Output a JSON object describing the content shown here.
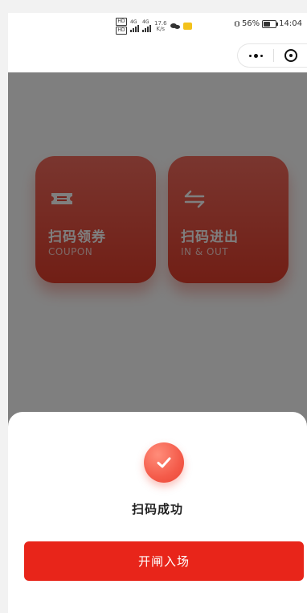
{
  "status_bar": {
    "sim1": "HD",
    "sim2": "HD",
    "net1": "4G",
    "net2": "4G",
    "net_speed_value": "17.6",
    "net_speed_unit": "K/s",
    "battery_text": "56%",
    "battery_level": 0.56,
    "time": "14:04",
    "icons": [
      "hd-icon",
      "signal-icon",
      "wechat-icon",
      "message-icon",
      "vibrate-icon",
      "battery-icon"
    ]
  },
  "capsule": {
    "more_icon": "more-dots-icon",
    "close_icon": "close-target-icon"
  },
  "cards": [
    {
      "title": "扫码领券",
      "subtitle": "COUPON",
      "icon": "ticket-icon"
    },
    {
      "title": "扫码进出",
      "subtitle": "IN & OUT",
      "icon": "swap-arrows-icon"
    }
  ],
  "sheet": {
    "icon": "checkmark-icon",
    "message": "扫码成功",
    "button_label": "开闸入场"
  },
  "colors": {
    "accent": "#e8251a",
    "card_top": "#f46c5e",
    "card_bottom": "#e23d2b",
    "overlay": "rgba(0,0,0,0.5)"
  }
}
